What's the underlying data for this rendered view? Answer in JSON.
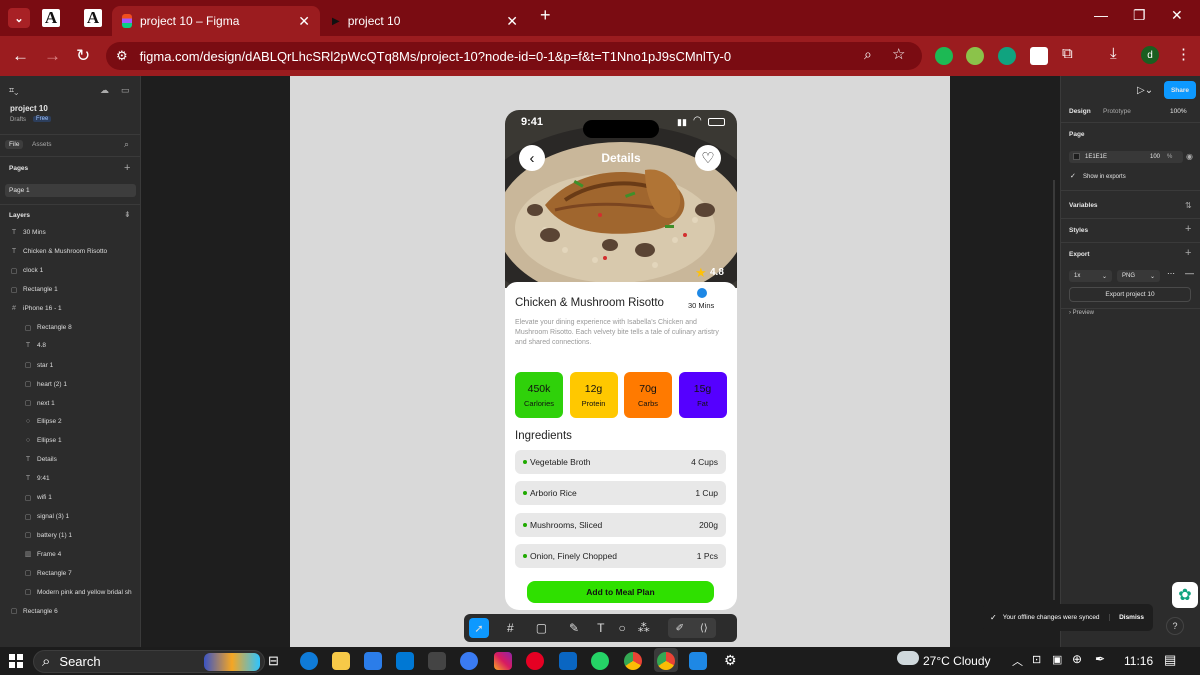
{
  "browser": {
    "tab1": "project 10 – Figma",
    "tab2": "project 10",
    "url": "figma.com/design/dABLQrLhcSRl2pWcQTq8Ms/project-10?node-id=0-1&p=f&t=T1Nno1pJ9sCMnlTy-0",
    "profile_initial": "d"
  },
  "left_panel": {
    "project_name": "project 10",
    "drafts": "Drafts",
    "plan": "Free",
    "tab_file": "File",
    "tab_assets": "Assets",
    "pages_title": "Pages",
    "page1": "Page 1",
    "layers_title": "Layers",
    "layers": [
      "30 Mins",
      "Chicken & Mushroom Risotto",
      "clock 1",
      "Rectangle 1",
      "iPhone 16 - 1",
      "Rectangle 8",
      "4.8",
      "star 1",
      "heart (2) 1",
      "next 1",
      "Ellipse 2",
      "Ellipse 1",
      "Details",
      "9:41",
      "wifi 1",
      "signal (3) 1",
      "battery (1) 1",
      "Frame 4",
      "Rectangle 7",
      "Modern pink and yellow bridal sh",
      "Rectangle 6"
    ]
  },
  "right_panel": {
    "share": "Share",
    "tab_design": "Design",
    "tab_prototype": "Prototype",
    "zoom": "100%",
    "page_label": "Page",
    "bg_hex": "1E1E1E",
    "bg_opacity": "100",
    "percent": "%",
    "show_exports": "Show in exports",
    "variables": "Variables",
    "styles": "Styles",
    "export_title": "Export",
    "scale": "1x",
    "format": "PNG",
    "export_button": "Export project 10",
    "preview": "Preview"
  },
  "phone": {
    "time": "9:41",
    "header": "Details",
    "rating": "4.8",
    "title": "Chicken & Mushroom Risotto",
    "duration": "30 Mins",
    "description": "Elevate your dining experience with Isabella's Chicken and Mushroom Risotto. Each velvety bite tells a tale of culinary artistry and shared connections.",
    "nutrition": [
      {
        "value": "450k",
        "label": "Carlories",
        "color": "#2fd10a"
      },
      {
        "value": "12g",
        "label": "Protein",
        "color": "#ffc800"
      },
      {
        "value": "70g",
        "label": "Carbs",
        "color": "#ff7a00"
      },
      {
        "value": "15g",
        "label": "Fat",
        "color": "#5500ff"
      }
    ],
    "ingredients_title": "Ingredients",
    "ingredients": [
      {
        "name": "Vegetable Broth",
        "amount": "4 Cups"
      },
      {
        "name": "Arborio Rice",
        "amount": "1 Cup"
      },
      {
        "name": "Mushrooms, Sliced",
        "amount": "200g"
      },
      {
        "name": "Onion, Finely Chopped",
        "amount": "1 Pcs"
      }
    ],
    "cta": "Add to Meal Plan",
    "cta_color": "#2fe000"
  },
  "toast": {
    "message": "Your offline changes were synced",
    "dismiss": "Dismiss"
  },
  "taskbar": {
    "search": "Search",
    "weather": "27°C  Cloudy",
    "time": "11:16"
  }
}
